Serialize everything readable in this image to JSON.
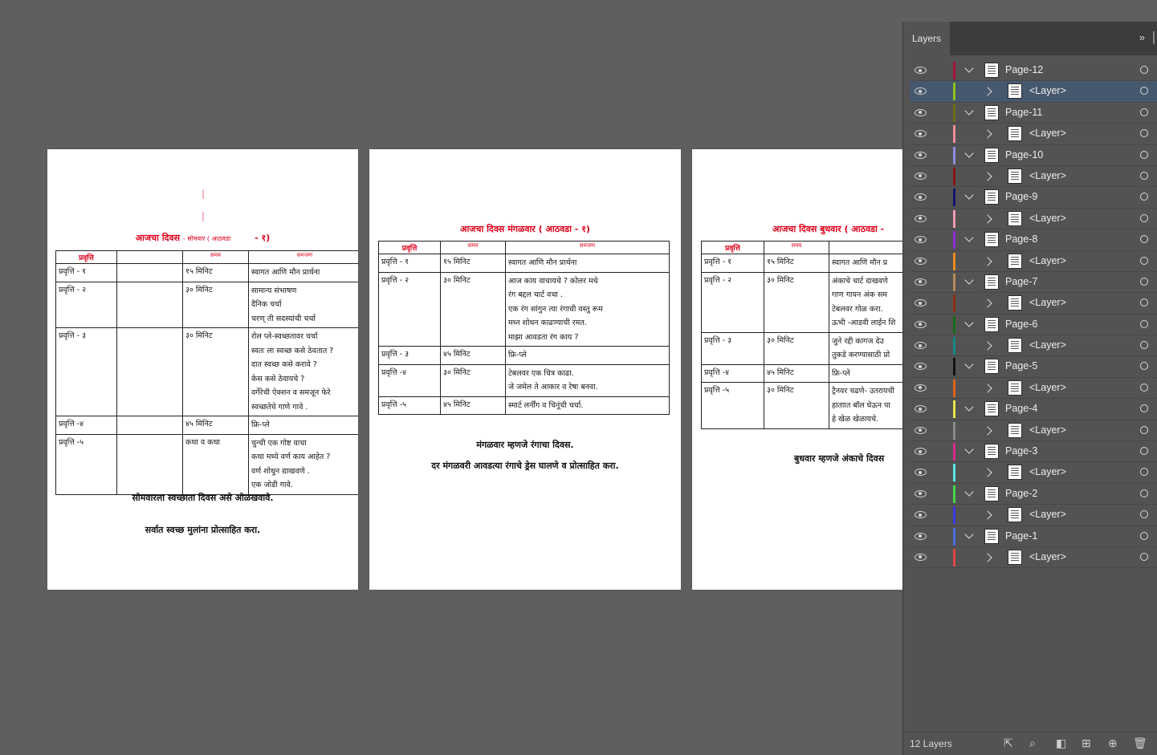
{
  "pages": {
    "left": {
      "title": "आजचा दिवस",
      "title_tail": "- सोमवार ( आठवडा",
      "title_num": "- १)",
      "headers": [
        "प्रवृत्ति",
        "",
        "समय",
        "समजण"
      ],
      "rows": [
        {
          "act": "प्रवृत्ति - १",
          "time": "१५ मिनिट",
          "lines": [
            "स्वागत आणि मौन प्रार्थना"
          ]
        },
        {
          "act": "प्रवृत्ति - २",
          "time": "३० मिनिट",
          "lines": [
            "सामान्य संभाषण",
            "दैनिक चर्चा",
            "चरण् ती सदस्यांची चर्चा"
          ]
        },
        {
          "act": "प्रवृत्ति - ३",
          "time": "३० मिनिट",
          "lines": [
            "रोल प्ले-स्वच्छतावर चर्चा",
            "स्वतः ला स्वच्छ कसे ठेवतात ?",
            "दात स्वच्छ कसे करावे ?",
            "केस कसे ठेवायचे ?",
            "वर्गेरेची ऐक्शन व समजून फेरे",
            "स्वच्छतेचे गाणे गावे ."
          ]
        },
        {
          "act": "प्रवृत्ति -४",
          "time": "४५ मिनिट",
          "lines": [
            "फ्रि-प्ले"
          ]
        },
        {
          "act": "प्रवृत्ति -५",
          "time": "कथा व कथा",
          "lines": [
            "चुन्ची एक गोष्ट वाचा",
            "कथा मध्ये वर्ण काय आहेत ?",
            "वर्ण शोधुन द्याखवणे .",
            "एक जोडी गावे."
          ]
        }
      ],
      "footer1": "सोमवारला स्वच्छाता दिवस असे ओळखवावे.",
      "footer2": "सर्वात स्वच्छ मुलांना प्रोत्साहित करा."
    },
    "middle": {
      "title": "आजचा दिवस मंगळवार ( आठवडा - १)",
      "headers": [
        "प्रवृत्ति",
        "समय",
        "समजण"
      ],
      "rows": [
        {
          "act": "प्रवृत्ति - १",
          "time": "१५ मिनिट",
          "lines": [
            "स्वागत आणि मौन प्रार्थना"
          ]
        },
        {
          "act": "प्रवृत्ति - २",
          "time": "३० मिनिट",
          "lines": [
            "आज काय वाचायचे ? कोलर मधे",
            "रंग बद्दल चार्ट वचा .",
            "एक रंग सांगुन त्या रंगाची वस्तु रूम",
            "मध्न शोधन काढण्याची रमत.",
            "माझा आवडता रंग काय ?"
          ]
        },
        {
          "act": "प्रवृत्ति - ३",
          "time": "४५ मिनिट",
          "lines": [
            "फ्रि-प्ले"
          ]
        },
        {
          "act": "प्रवृत्ति -४",
          "time": "३० मिनिट",
          "lines": [
            "टेबलवर एक चित्र काढा.",
            "जे जमेल ते आकार व रेषा बनवा."
          ]
        },
        {
          "act": "प्रवृत्ति -५",
          "time": "४५ मिनिट",
          "lines": [
            "स्मार्ट लर्नींग व चिनूंची चर्चा."
          ]
        }
      ],
      "footer1": "मंगळवार म्हणजे रंगाचा दिवस.",
      "footer2": "दर मंगळवरी आवडत्या रंगाचे ड्रेस घालणे व प्रोत्साहित करा."
    },
    "right": {
      "title": "आजचा दिवस बुधवार ( आठवडा -",
      "headers": [
        "प्रवृत्ति",
        "समय",
        "सम"
      ],
      "rows": [
        {
          "act": "प्रवृत्ति - १",
          "time": "१५ मिनिट",
          "lines": [
            "स्वागत आणि मौन प्र"
          ]
        },
        {
          "act": "प्रवृत्ति - २",
          "time": "३० मिनिट",
          "lines": [
            "अंकाचे चार्ट दाखवणे",
            "गाण गायन अंक सम",
            "टेबलवर गोळ करा.",
            "ऊभी -आडवी लाईन शि"
          ]
        },
        {
          "act": "प्रवृत्ति - ३",
          "time": "३० मिनिट",
          "lines": [
            "जुने रद्दी कागज देउ",
            "तुकडे करण्यासाठी प्रो"
          ]
        },
        {
          "act": "प्रवृत्ति -४",
          "time": "४५ मिनिट",
          "lines": [
            "फ्रि-प्ले"
          ]
        },
        {
          "act": "प्रवृत्ति -५",
          "time": "३० मिनिट",
          "lines": [
            "ट्रैनवर चढणे- उतरायची",
            "हाताात बॉल घेऊन पा",
            "हे खेळ खेळायचे."
          ]
        }
      ],
      "footer1": "बुधवार म्हणजे अंकाचे दिवस"
    }
  },
  "layers_panel": {
    "tab_label": "Layers",
    "collapse_icon": "»",
    "footer_count": "12 Layers",
    "layers": [
      {
        "name": "Page-12",
        "color": "#a3123a",
        "sub": "<Layer>",
        "sub_color": "#8fc21a"
      },
      {
        "name": "Page-11",
        "color": "#6e6a12",
        "sub": "<Layer>",
        "sub_color": "#f08c96"
      },
      {
        "name": "Page-10",
        "color": "#8d8ddc",
        "sub": "<Layer>",
        "sub_color": "#8b1414"
      },
      {
        "name": "Page-9",
        "color": "#14146e",
        "sub": "<Layer>",
        "sub_color": "#f29ab0"
      },
      {
        "name": "Page-8",
        "color": "#8b2fd6",
        "sub": "<Layer>",
        "sub_color": "#ee8a1a"
      },
      {
        "name": "Page-7",
        "color": "#b88a5a",
        "sub": "<Layer>",
        "sub_color": "#8a2f10"
      },
      {
        "name": "Page-6",
        "color": "#1a6a1a",
        "sub": "<Layer>",
        "sub_color": "#148a8a"
      },
      {
        "name": "Page-5",
        "color": "#111111",
        "sub": "<Layer>",
        "sub_color": "#e0641a"
      },
      {
        "name": "Page-4",
        "color": "#e6e64a",
        "sub": "<Layer>",
        "sub_color": "#8a8a8a"
      },
      {
        "name": "Page-3",
        "color": "#d62a8a",
        "sub": "<Layer>",
        "sub_color": "#5ae6e6"
      },
      {
        "name": "Page-2",
        "color": "#46d646",
        "sub": "<Layer>",
        "sub_color": "#3a3ae0"
      },
      {
        "name": "Page-1",
        "color": "#4a6ae0",
        "sub": "<Layer>",
        "sub_color": "#e04646"
      }
    ]
  }
}
